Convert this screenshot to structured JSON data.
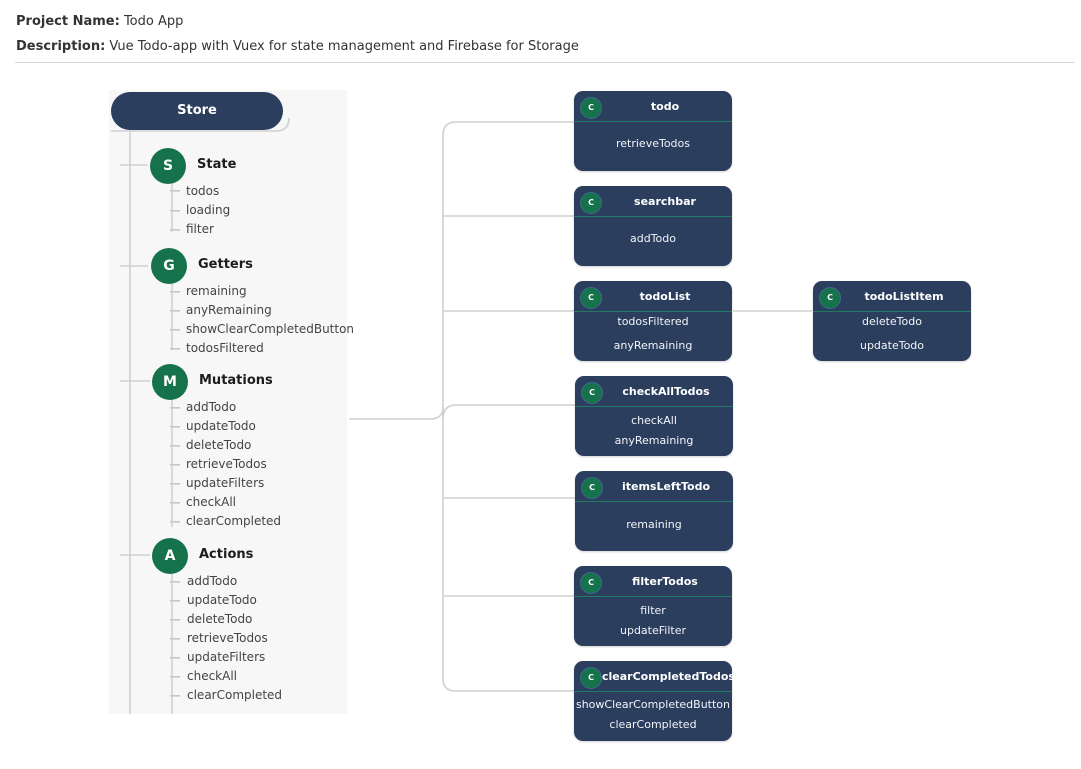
{
  "project": {
    "name_label": "Project Name:",
    "name": "Todo App",
    "description_label": "Description:",
    "description": "Vue Todo-app with Vuex for state management and Firebase for Storage"
  },
  "store": {
    "title": "Store",
    "groups": [
      {
        "badge": "S",
        "title": "State",
        "items": [
          "todos",
          "loading",
          "filter"
        ]
      },
      {
        "badge": "G",
        "title": "Getters",
        "items": [
          "remaining",
          "anyRemaining",
          "showClearCompletedButton",
          "todosFiltered"
        ]
      },
      {
        "badge": "M",
        "title": "Mutations",
        "items": [
          "addTodo",
          "updateTodo",
          "deleteTodo",
          "retrieveTodos",
          "updateFilters",
          "checkAll",
          "clearCompleted"
        ]
      },
      {
        "badge": "A",
        "title": "Actions",
        "items": [
          "addTodo",
          "updateTodo",
          "deleteTodo",
          "retrieveTodos",
          "updateFilters",
          "checkAll",
          "clearCompleted"
        ]
      }
    ]
  },
  "components": [
    {
      "badge": "C",
      "title": "todo",
      "methods": [
        "retrieveTodos"
      ]
    },
    {
      "badge": "C",
      "title": "searchbar",
      "methods": [
        "addTodo"
      ]
    },
    {
      "badge": "C",
      "title": "todoList",
      "methods": [
        "todosFiltered",
        "anyRemaining"
      ]
    },
    {
      "badge": "C",
      "title": "checkAllTodos",
      "methods": [
        "checkAll",
        "anyRemaining"
      ]
    },
    {
      "badge": "C",
      "title": "itemsLeftTodo",
      "methods": [
        "remaining"
      ]
    },
    {
      "badge": "C",
      "title": "filterTodos",
      "methods": [
        "filter",
        "updateFilter"
      ]
    },
    {
      "badge": "C",
      "title": "clearCompletedTodos",
      "methods": [
        "showClearCompletedButton",
        "clearCompleted"
      ]
    },
    {
      "badge": "C",
      "title": "todoListItem",
      "methods": [
        "deleteTodo",
        "updateTodo"
      ]
    }
  ],
  "colors": {
    "card": "#2b3e5e",
    "badge": "#15724a",
    "wire": "#d0d0d0"
  }
}
